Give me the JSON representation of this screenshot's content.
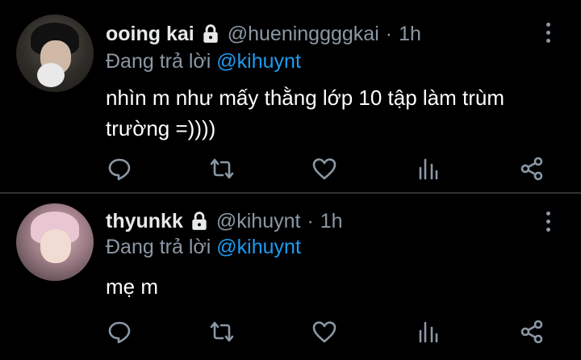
{
  "tweets": [
    {
      "display_name": "ooing kai",
      "handle": "@hueninggggkai",
      "separator": "·",
      "time": "1h",
      "reply_prefix": "Đang trả lời",
      "reply_mention": "@kihuynt",
      "text": "nhìn m như mấy thằng lớp 10 tập làm trùm trường =))))",
      "locked": true,
      "avatar_icon": "avatar-photo"
    },
    {
      "display_name": "thyunkk",
      "handle": "@kihuynt",
      "separator": "·",
      "time": "1h",
      "reply_prefix": "Đang trả lời",
      "reply_mention": "@kihuynt",
      "text": "mẹ m",
      "locked": true,
      "avatar_icon": "avatar-photo"
    }
  ],
  "action_icons": [
    "reply-icon",
    "retweet-icon",
    "like-icon",
    "analytics-icon",
    "share-icon"
  ],
  "colors": {
    "background": "#000000",
    "primary_text": "#e7e9ea",
    "secondary_text": "#8b98a5",
    "mention": "#1d9bf0",
    "divider": "#2f3336"
  }
}
